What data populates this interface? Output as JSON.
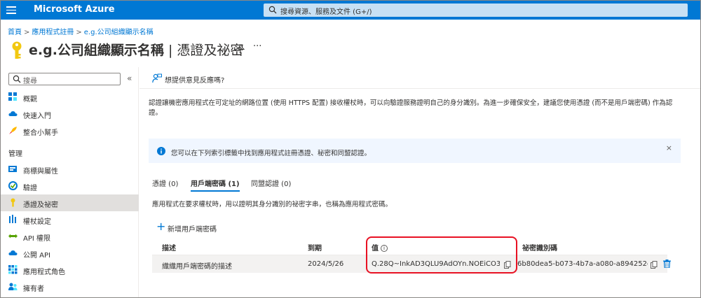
{
  "topbar": {
    "brand": "Microsoft Azure",
    "search_placeholder": "搜尋資源、服務及文件 (G+/)"
  },
  "breadcrumb": [
    "首頁",
    "應用程式註冊",
    "e.g.公司組織顯示名稱"
  ],
  "page": {
    "title_bold": "e.g.公司組織顯示名稱",
    "title_sep": " | ",
    "title_light": "憑證及祕密",
    "more": "···"
  },
  "sidebar": {
    "search_placeholder": "搜尋",
    "collapse": "«",
    "items_top": [
      {
        "label": "概觀",
        "icon": "overview-grid-icon"
      },
      {
        "label": "快速入門",
        "icon": "cloud-quickstart-icon"
      },
      {
        "label": "整合小幫手",
        "icon": "rocket-icon"
      }
    ],
    "section": "管理",
    "items_manage": [
      {
        "label": "商標與屬性",
        "icon": "branding-icon"
      },
      {
        "label": "驗證",
        "icon": "authentication-icon"
      },
      {
        "label": "憑證及祕密",
        "icon": "key-icon",
        "active": true
      },
      {
        "label": "權杖設定",
        "icon": "token-bars-icon"
      },
      {
        "label": "API 權限",
        "icon": "api-permission-icon"
      },
      {
        "label": "公開 API",
        "icon": "cloud-api-icon"
      },
      {
        "label": "應用程式角色",
        "icon": "app-roles-icon"
      },
      {
        "label": "擁有者",
        "icon": "owners-icon"
      }
    ]
  },
  "content": {
    "feedback": "想提供意見反應嗎?",
    "description": "認證讓機密應用程式在可定址的網路位置 (使用 HTTPS 配置) 接收權杖時，可以向驗證服務證明自己的身分識別。為進一步確保安全，建議您使用憑證 (而不是用戶端密碼) 作為認證。",
    "info": "您可以在下列索引標籤中找到應用程式註冊憑證、秘密和同盟認證。",
    "info_close": "×",
    "tabs": [
      {
        "label": "憑證 (0)"
      },
      {
        "label": "用戶端密碼 (1)",
        "active": true
      },
      {
        "label": "同盟認證 (0)"
      }
    ],
    "secret_description": "應用程式在要求權杖時，用以證明其身分識別的祕密字串，也稱為應用程式密碼。",
    "add_button": "新增用戶端密碼",
    "table": {
      "headers": {
        "description": "描述",
        "expires": "到期",
        "value": "值",
        "secret_id": "祕密識別碼"
      },
      "rows": [
        {
          "description": "織織用戶端密碼的描述",
          "expires": "2024/5/26",
          "value": "Q.28Q~InkAD3QLU9AdOYn.NOEiCO3...",
          "secret_id": "6b80dea5-b073-4b7a-a080-a894252d..."
        }
      ]
    }
  },
  "colors": {
    "azure_blue": "#0078d4",
    "highlight_red": "#e81123",
    "key_yellow": "#f2c811"
  }
}
